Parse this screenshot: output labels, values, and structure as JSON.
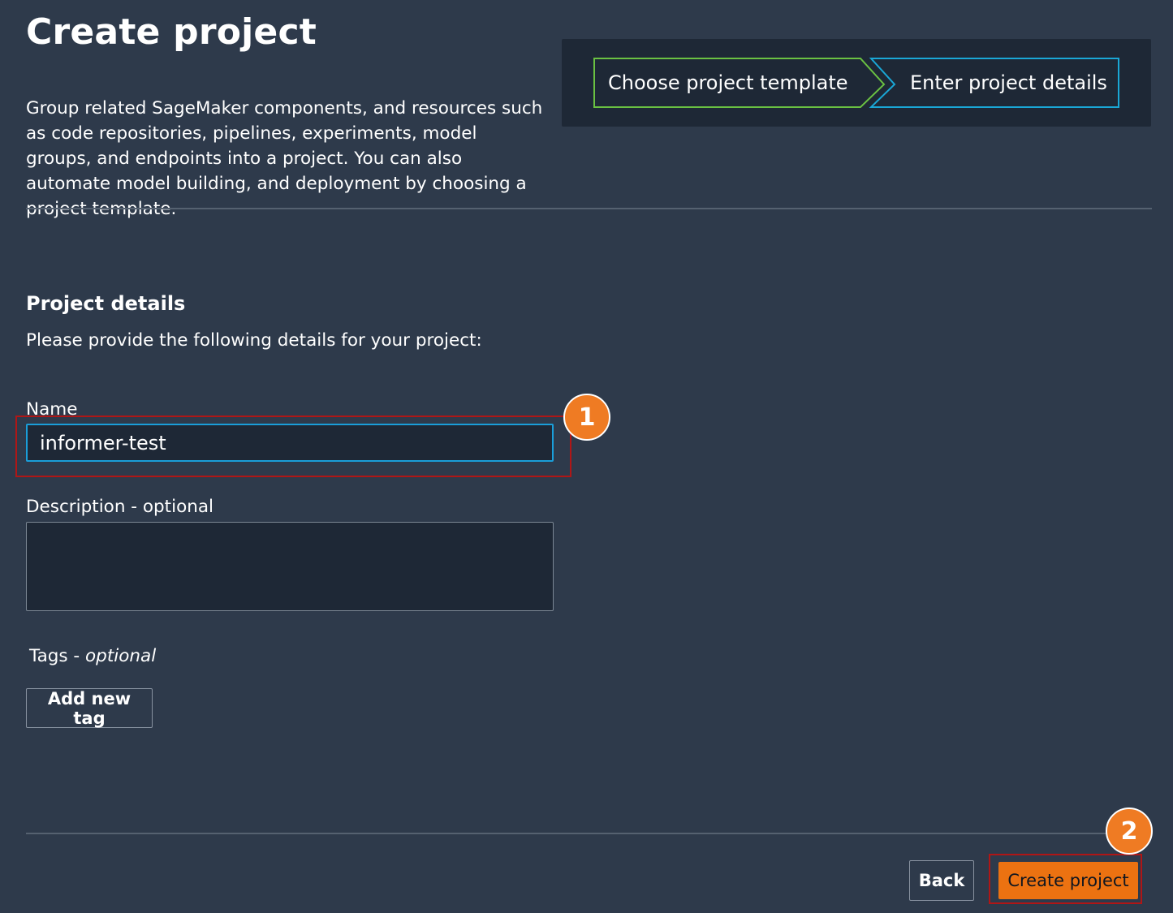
{
  "page": {
    "title": "Create project",
    "description": "Group related SageMaker components, and resources such as code repositories, pipelines, experiments, model groups, and endpoints into a project. You can also automate model building, and deployment by choosing a project template."
  },
  "stepper": {
    "steps": [
      {
        "label": "Choose project template",
        "state": "completed",
        "color": "#6ac142"
      },
      {
        "label": "Enter project details",
        "state": "current",
        "color": "#1aa7d6"
      }
    ]
  },
  "project_details": {
    "heading": "Project details",
    "subheading": "Please provide the following details for your project:",
    "name": {
      "label": "Name",
      "value": "informer-test"
    },
    "description": {
      "label": "Description - optional",
      "value": ""
    },
    "tags": {
      "label": "Tags - ",
      "label_optional": "optional",
      "add_button": "Add new tag"
    }
  },
  "footer": {
    "back_label": "Back",
    "create_label": "Create project"
  },
  "annotations": {
    "badge_1": "1",
    "badge_2": "2",
    "highlight_color": "#b01616",
    "badge_color": "#ef7b23"
  },
  "colors": {
    "background": "#2e3a4b",
    "panel": "#1e2836",
    "primary_button": "#ec7211",
    "focus_border": "#1a9ed9"
  }
}
